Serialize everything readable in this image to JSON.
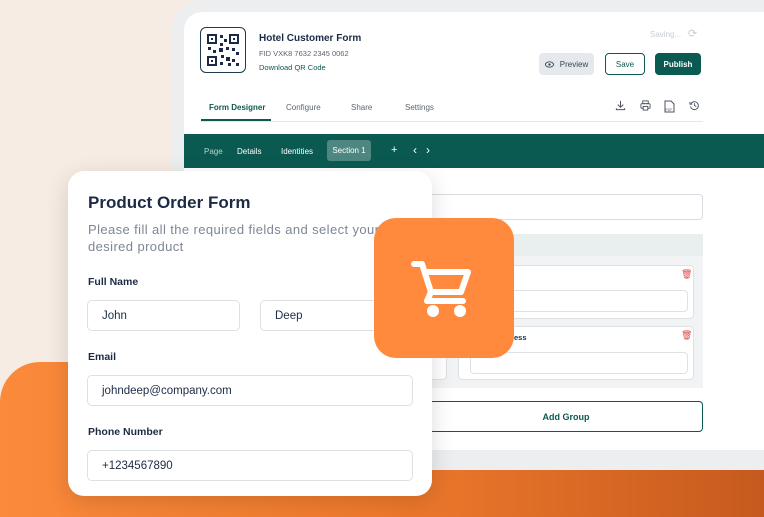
{
  "builder": {
    "form_title": "Hotel Customer Form",
    "fid": "FID VXK8 7632 2345 0062",
    "qr_link": "Download QR Code",
    "saving": "Saving...",
    "buttons": {
      "preview": "Preview",
      "save": "Save",
      "publish": "Publish"
    },
    "tabs": [
      "Form Designer",
      "Configure",
      "Share",
      "Settings"
    ],
    "section_bar": {
      "page": "Page",
      "details": "Details",
      "identities": "Identities",
      "section": "Section 1",
      "add": "+",
      "prev": "‹",
      "next": "›"
    },
    "partial_label": "ess",
    "add_group": "Add Group"
  },
  "product_form": {
    "title": "Product Order Form",
    "subtitle": "Please fill all the required fields and select your desired product",
    "full_name_label": "Full Name",
    "first_name": "John",
    "last_name": "Deep",
    "email_label": "Email",
    "email": "johndeep@company.com",
    "phone_label": "Phone Number",
    "phone": "+1234567890"
  },
  "icons": [
    "qr-code-icon",
    "refresh-icon",
    "eye-icon",
    "download-icon",
    "print-icon",
    "pdf-icon",
    "history-icon",
    "trash-icon",
    "cart-icon"
  ],
  "colors": {
    "brand_green": "#0b5a51",
    "accent_orange": "#ff8a3d",
    "danger": "#e04848"
  }
}
